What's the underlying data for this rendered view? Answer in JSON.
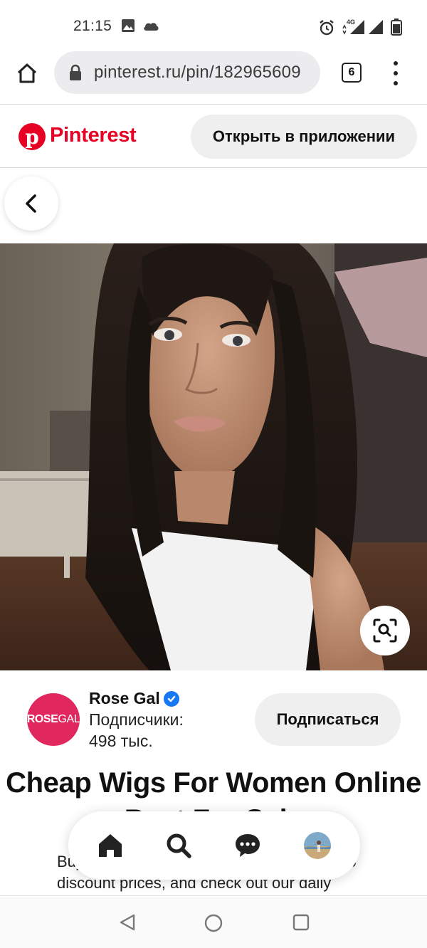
{
  "status_bar": {
    "time": "21:15",
    "icons": [
      "image-icon",
      "cloud-icon",
      "alarm-icon",
      "4g-signal-icon",
      "signal-icon",
      "battery-icon"
    ],
    "network_label": "4G"
  },
  "browser": {
    "url": "pinterest.ru/pin/182965609",
    "tab_count": "6",
    "icons": [
      "home-icon",
      "lock-icon",
      "tab-switcher-icon",
      "overflow-menu-icon"
    ]
  },
  "pinterest_header": {
    "brand": "Pinterest",
    "open_in_app": "Открыть в приложении",
    "brand_color": "#e60023"
  },
  "pin": {
    "creator": {
      "avatar_text_bold": "ROSE",
      "avatar_text_light": "GAL",
      "name": "Rose Gal",
      "followers_label": "Подписчики:",
      "followers_count": "498 тыс.",
      "subscribe_label": "Подписаться"
    },
    "title": "Cheap Wigs For Women Online Best For Sale",
    "description": "Buy cheap wigs online at a great deal up to discount prices, and check out our daily"
  },
  "bottom_nav": {
    "items": [
      "home-icon",
      "search-icon",
      "messages-icon",
      "profile-avatar"
    ]
  },
  "system_nav": {
    "icons": [
      "back-triangle-icon",
      "home-circle-icon",
      "recents-square-icon"
    ]
  }
}
